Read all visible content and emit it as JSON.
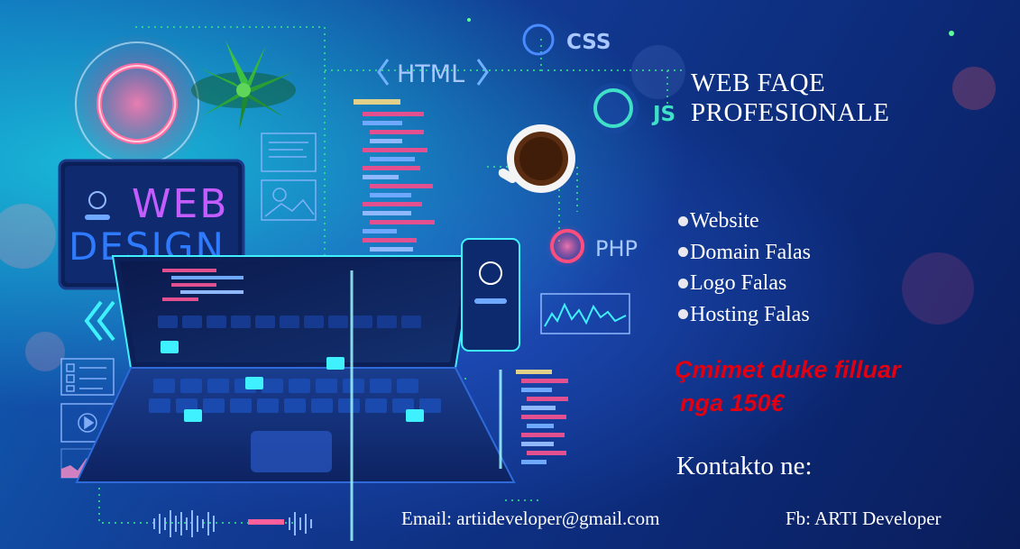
{
  "headline": {
    "line1": "WEB FAQE",
    "line2": "PROFESIONALE"
  },
  "features": [
    "Website",
    "Domain Falas",
    "Logo Falas",
    "Hosting Falas"
  ],
  "price": {
    "line1": "Çmimet duke filluar",
    "line2": "nga 150€"
  },
  "contact_heading": "Kontakto ne:",
  "email": "Email: artiideveloper@gmail.com",
  "facebook": "Fb: ARTI Developer",
  "illustration": {
    "tags": {
      "html": "HTML",
      "css": "CSS",
      "js": "JS",
      "php": "PHP"
    },
    "tablet_text": {
      "line1": "WEB",
      "line2": "DESIGN"
    },
    "colors": {
      "accent_cyan": "#3ff0ff",
      "accent_pink": "#ff3d7f",
      "price_red": "#e00012",
      "code_pink": "#e2508f",
      "code_blue": "#6fa8ff"
    }
  }
}
